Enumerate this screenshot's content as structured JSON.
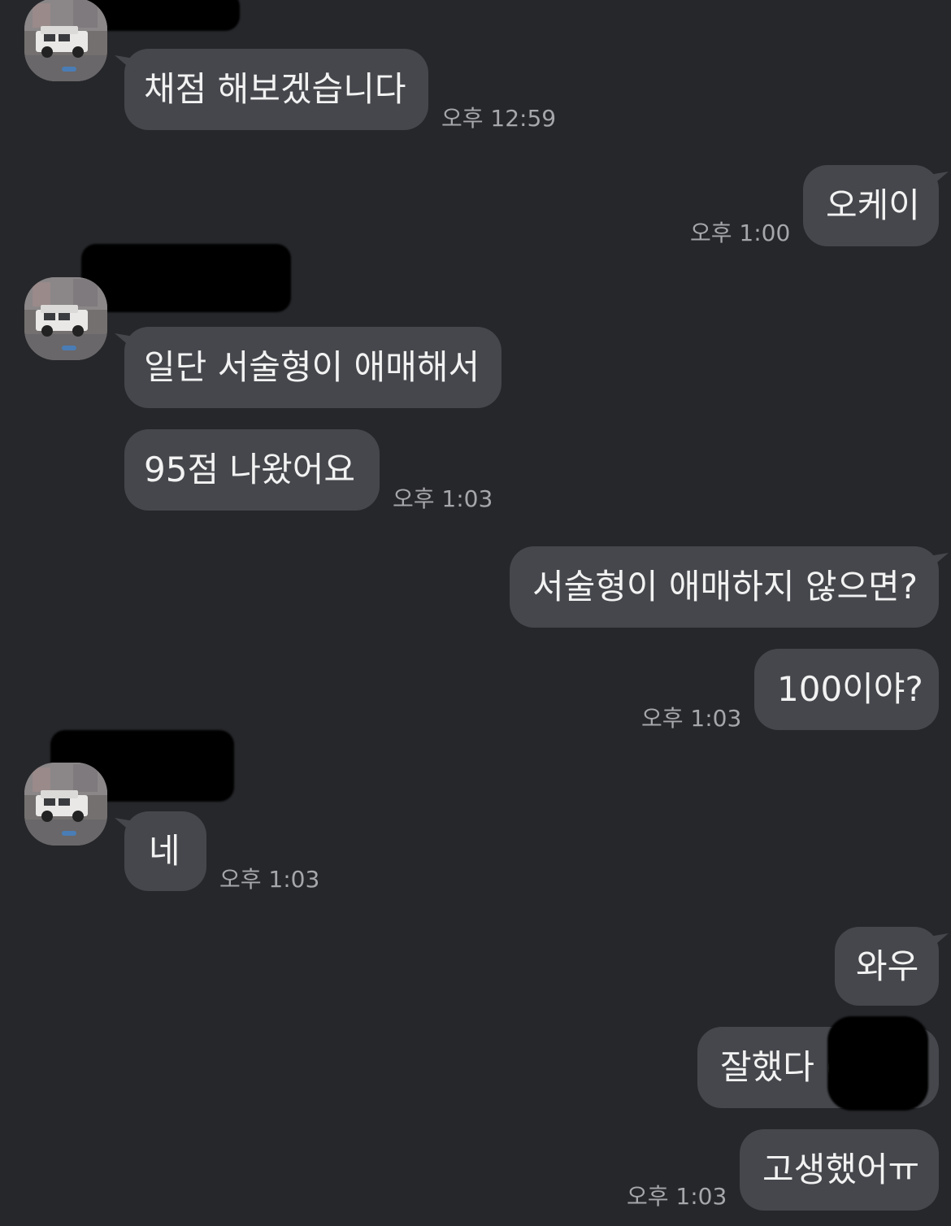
{
  "chat": {
    "messages": [
      {
        "id": "m1",
        "side": "left",
        "text": "채점 해보겠습니다",
        "time": "오후 12:59"
      },
      {
        "id": "m2",
        "side": "right",
        "text": "오케이",
        "time": "오후 1:00"
      },
      {
        "id": "m3",
        "side": "left",
        "text": "일단 서술형이 애매해서"
      },
      {
        "id": "m4",
        "side": "left",
        "text": "95점 나왔어요",
        "time": "오후 1:03"
      },
      {
        "id": "m5",
        "side": "right",
        "text": "서술형이 애매하지 않으면?"
      },
      {
        "id": "m6",
        "side": "right",
        "text": "100이야?",
        "time": "오후 1:03"
      },
      {
        "id": "m7",
        "side": "left",
        "text": "네",
        "time": "오후 1:03"
      },
      {
        "id": "m8",
        "side": "right",
        "text": "와우"
      },
      {
        "id": "m9",
        "side": "right",
        "text": "잘했다 ("
      },
      {
        "id": "m10",
        "side": "right",
        "text": "고생했어ㅠ",
        "time": "오후 1:03"
      }
    ]
  },
  "icons": {
    "avatar": "car-photo-avatar"
  },
  "colors": {
    "background": "#26272b",
    "bubble": "#45474c",
    "text": "#f2f2f2",
    "time": "#a6a7ab"
  }
}
